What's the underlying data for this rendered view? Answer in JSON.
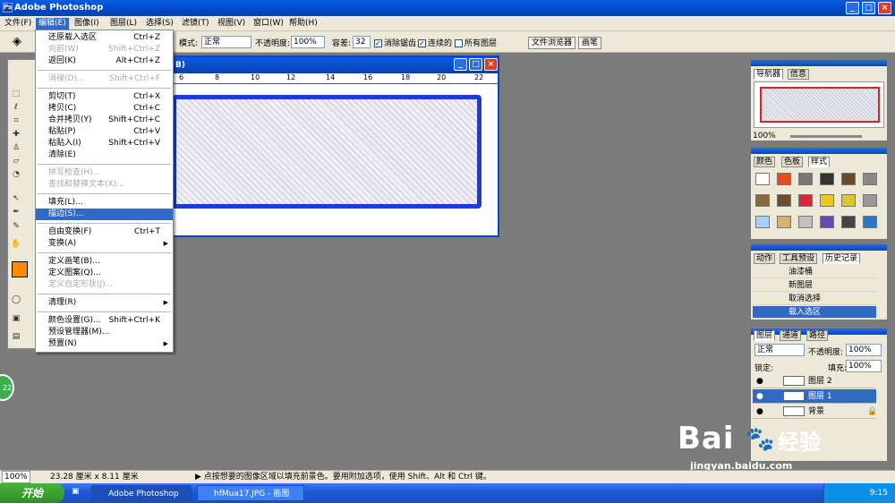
{
  "app": {
    "title": "Adobe Photoshop",
    "window_buttons": [
      "_",
      "□",
      "×"
    ]
  },
  "menubar": {
    "items": [
      "文件(F)",
      "编辑(E)",
      "图像(I)",
      "图层(L)",
      "选择(S)",
      "滤镜(T)",
      "视图(V)",
      "窗口(W)",
      "帮助(H)"
    ]
  },
  "options": {
    "mode_label": "模式:",
    "mode_value": "正常",
    "opacity_label": "不透明度:",
    "opacity_value": "100%",
    "tolerance_label": "容差:",
    "tolerance_value": "32",
    "antialias": "消除锯齿",
    "contiguous": "连续的",
    "all_layers": "所有图层",
    "file_browser": "文件浏览器",
    "brushes": "画笔"
  },
  "document": {
    "title": "B)",
    "ruler": [
      "6",
      "8",
      "10",
      "12",
      "14",
      "16",
      "18",
      "20",
      "22"
    ]
  },
  "edit_menu": {
    "items": [
      {
        "label": "还原载入选区",
        "shortcut": "Ctrl+Z",
        "state": "normal"
      },
      {
        "label": "向前(W)",
        "shortcut": "Shift+Ctrl+Z",
        "state": "disabled"
      },
      {
        "label": "返回(K)",
        "shortcut": "Alt+Ctrl+Z",
        "state": "normal"
      },
      {
        "label": "消褪(D)...",
        "shortcut": "Shift+Ctrl+F",
        "state": "disabled"
      },
      {
        "label": "剪切(T)",
        "shortcut": "Ctrl+X",
        "state": "normal"
      },
      {
        "label": "拷贝(C)",
        "shortcut": "Ctrl+C",
        "state": "normal"
      },
      {
        "label": "合并拷贝(Y)",
        "shortcut": "Shift+Ctrl+C",
        "state": "normal"
      },
      {
        "label": "粘贴(P)",
        "shortcut": "Ctrl+V",
        "state": "normal"
      },
      {
        "label": "粘贴入(I)",
        "shortcut": "Shift+Ctrl+V",
        "state": "normal"
      },
      {
        "label": "清除(E)",
        "shortcut": "",
        "state": "normal"
      },
      {
        "label": "拼写检查(H)...",
        "shortcut": "",
        "state": "disabled"
      },
      {
        "label": "查找和替换文本(X)...",
        "shortcut": "",
        "state": "disabled"
      },
      {
        "label": "填充(L)...",
        "shortcut": "",
        "state": "normal"
      },
      {
        "label": "描边(S)...",
        "shortcut": "",
        "state": "highlighted"
      },
      {
        "label": "自由变换(F)",
        "shortcut": "Ctrl+T",
        "state": "normal"
      },
      {
        "label": "变换(A)",
        "shortcut": "▶",
        "state": "normal"
      },
      {
        "label": "定义画笔(B)...",
        "shortcut": "",
        "state": "normal"
      },
      {
        "label": "定义图案(Q)...",
        "shortcut": "",
        "state": "normal"
      },
      {
        "label": "定义自定形状(J)...",
        "shortcut": "",
        "state": "disabled"
      },
      {
        "label": "清理(R)",
        "shortcut": "▶",
        "state": "normal"
      },
      {
        "label": "颜色设置(G)...",
        "shortcut": "Shift+Ctrl+K",
        "state": "normal"
      },
      {
        "label": "预设管理器(M)...",
        "shortcut": "",
        "state": "normal"
      },
      {
        "label": "预置(N)",
        "shortcut": "▶",
        "state": "normal"
      }
    ]
  },
  "navigator": {
    "tabs": [
      "导航器",
      "信息"
    ],
    "zoom": "100%"
  },
  "swatches": {
    "tabs": [
      "颜色",
      "色板",
      "样式"
    ]
  },
  "history": {
    "tabs": [
      "动作",
      "工具预设",
      "历史记录"
    ],
    "items": [
      "油漆桶",
      "新图层",
      "取消选择",
      "载入选区"
    ]
  },
  "layers": {
    "tabs": [
      "图层",
      "通道",
      "路径"
    ],
    "blend": "正常",
    "opacity_label": "不透明度:",
    "opacity": "100%",
    "lock_label": "锁定:",
    "fill_label": "填充:",
    "fill": "100%",
    "rows": [
      "图层 2",
      "图层 1",
      "背景"
    ]
  },
  "status": {
    "zoom": "100%",
    "size": "23.28 厘米 x 8.11 厘米",
    "hint": "点按想要的图像区域以填充前景色。要用附加选项，使用 Shift、Alt 和 Ctrl 键。"
  },
  "taskbar": {
    "start": "开始",
    "tasks": [
      "Adobe Photoshop",
      "hfMua17.JPG - 画图"
    ],
    "time": "9:15"
  },
  "watermark": {
    "brand": "Bai",
    "paw": "du",
    "cn": "经验",
    "url": "jingyan.baidu.com"
  },
  "colors": {
    "foreground": "#ff8c00",
    "selection": "#1c3cd8",
    "highlight": "#316ac5"
  },
  "side_badge": "22"
}
